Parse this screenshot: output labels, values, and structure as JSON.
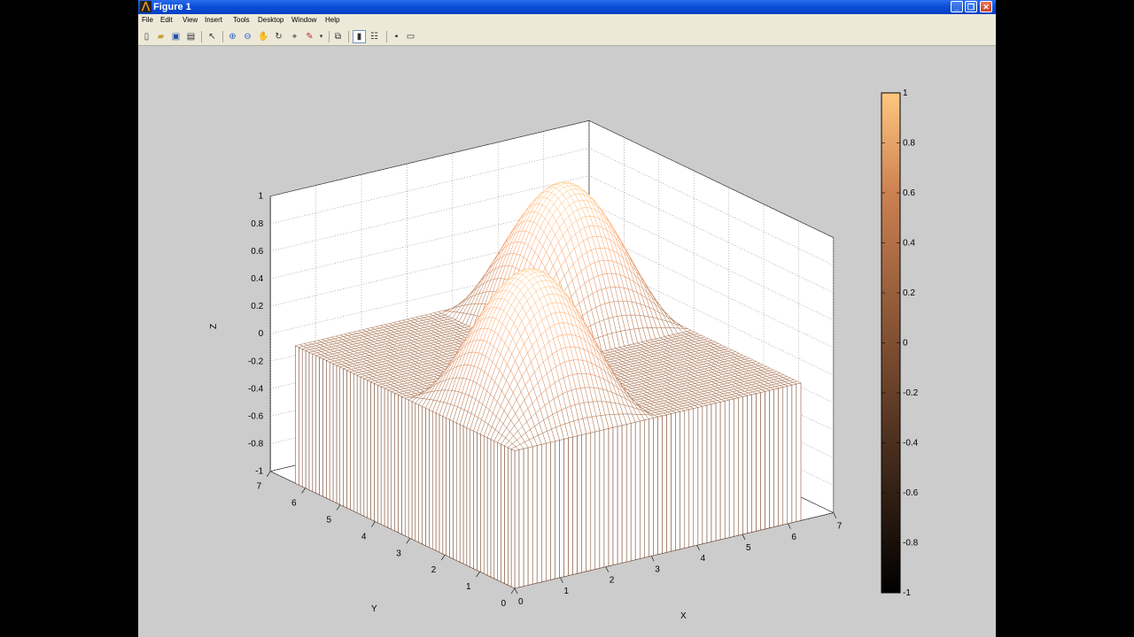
{
  "window": {
    "title": "Figure 1"
  },
  "menu": [
    "File",
    "Edit",
    "View",
    "Insert",
    "Tools",
    "Desktop",
    "Window",
    "Help"
  ],
  "toolbar": {
    "buttons": [
      "new-figure",
      "open-file",
      "save-figure",
      "print-figure",
      "edit-plot",
      "zoom-in",
      "zoom-out",
      "pan",
      "rotate-3d",
      "data-cursor",
      "insert-colorbar",
      "link-plot",
      "hide-plot-tools",
      "show-plot-tools",
      "dock-figure"
    ]
  },
  "colors": {
    "titlebar": "#0a4fd8",
    "figure_bg": "#cccccc",
    "colormap_low": "#000000",
    "colormap_high": "#ffc77f"
  },
  "chart_data": {
    "type": "surface",
    "colormap": "copper",
    "function": "Z = sin(X)·sin(Y) over 0..2π, clipped at 0 (two peaks at 1)",
    "x": [
      0,
      0.7854,
      1.5708,
      2.3562,
      3.1416,
      3.927,
      4.7124,
      5.4978,
      6.2832
    ],
    "y": [
      0,
      0.7854,
      1.5708,
      2.3562,
      3.1416,
      3.927,
      4.7124,
      5.4978,
      6.2832
    ],
    "peaks": [
      {
        "x": 1.5708,
        "y": 1.5708,
        "z": 1
      },
      {
        "x": 4.7124,
        "y": 4.7124,
        "z": 1
      }
    ],
    "xlabel": "X",
    "ylabel": "Y",
    "zlabel": "Z",
    "xlim": [
      0,
      7
    ],
    "ylim": [
      0,
      7
    ],
    "zlim": [
      -1,
      1
    ],
    "xticks": [
      "0",
      "1",
      "2",
      "3",
      "4",
      "5",
      "6",
      "7"
    ],
    "yticks": [
      "0",
      "1",
      "2",
      "3",
      "4",
      "5",
      "6",
      "7"
    ],
    "zticks": [
      "-1",
      "-0.8",
      "-0.6",
      "-0.4",
      "-0.2",
      "0",
      "0.2",
      "0.4",
      "0.6",
      "0.8",
      "1"
    ],
    "grid": true,
    "colorbar": {
      "ticks": [
        "-1",
        "-0.8",
        "-0.6",
        "-0.4",
        "-0.2",
        "0",
        "0.2",
        "0.4",
        "0.6",
        "0.8",
        "1"
      ],
      "range": [
        -1,
        1
      ],
      "placement": "right"
    }
  }
}
